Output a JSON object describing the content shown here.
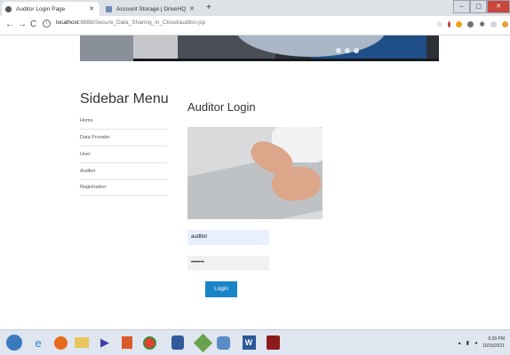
{
  "browser": {
    "tabs": [
      {
        "label": "Auditor Login Page",
        "active": true
      },
      {
        "label": "Account Storage | DriveHQ",
        "active": false
      }
    ],
    "new_tab_symbol": "+",
    "url_host": "localhost",
    "url_rest": ":8888/Secure_Data_Sharing_in_Cloud/auditor.jsp",
    "nav_icons": [
      "back-icon",
      "forward-icon",
      "reload-icon"
    ]
  },
  "sidebar": {
    "title": "Sidebar Menu",
    "items": [
      {
        "label": "Home"
      },
      {
        "label": "Data Provider"
      },
      {
        "label": "User"
      },
      {
        "label": "Auditor"
      },
      {
        "label": "Registration"
      }
    ]
  },
  "main": {
    "title": "Auditor Login",
    "username_value": "auditor",
    "password_value": "•••••••",
    "login_label": "Login"
  },
  "taskbar": {
    "time": "6:39 PM",
    "date": "10/16/2021",
    "icons": [
      "start-orb-icon",
      "ie-icon",
      "firefox-icon",
      "explorer-icon",
      "media-player-icon",
      "office-icon",
      "chrome-icon",
      "vm-icon",
      "paint-icon",
      "app-icon",
      "word-icon",
      "filezilla-icon"
    ]
  },
  "colors": {
    "accent": "#1a84c8",
    "username_bg": "#e8f0fe",
    "taskbar_bg": "#dfe6ef"
  }
}
